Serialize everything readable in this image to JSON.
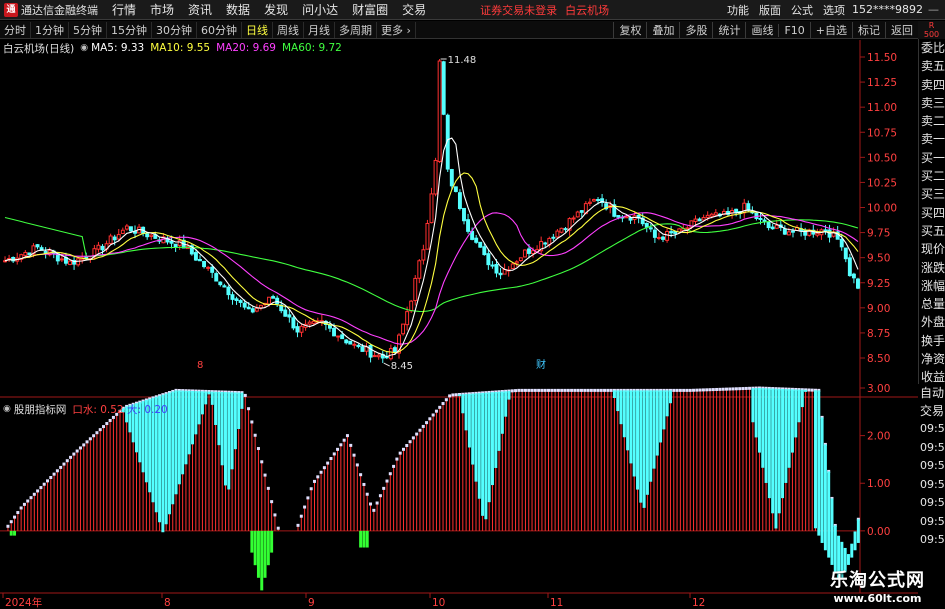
{
  "app": {
    "name": "通达信金融终端",
    "logo_text": "通"
  },
  "menu": [
    "行情",
    "市场",
    "资讯",
    "数据",
    "发现",
    "问小达",
    "财富圈",
    "交易"
  ],
  "warning": "证券交易未登录",
  "stock_name": "白云机场",
  "right_menu": [
    "功能",
    "版面",
    "公式",
    "选项"
  ],
  "user": "152****9892",
  "periods": [
    "分时",
    "1分钟",
    "5分钟",
    "15分钟",
    "30分钟",
    "60分钟",
    "日线",
    "周线",
    "月线",
    "多周期",
    "更多"
  ],
  "active_period": "日线",
  "right_tools": [
    "复权",
    "叠加",
    "多股",
    "统计",
    "画线",
    "F10",
    "+自选",
    "标记",
    "返回"
  ],
  "badge": {
    "line1": "R",
    "line2": "500"
  },
  "main_legend": {
    "title": "白云机场(日线)",
    "ma": [
      {
        "label": "MA5: 9.33",
        "color": "#ffffff"
      },
      {
        "label": "MA10: 9.55",
        "color": "#ffff40"
      },
      {
        "label": "MA20: 9.69",
        "color": "#ff40ff"
      },
      {
        "label": "MA60: 9.72",
        "color": "#40ff40"
      }
    ]
  },
  "sub_legend": {
    "title": "股朋指标网",
    "items": [
      {
        "label": "口水: 0.52",
        "color": "#ff4040"
      },
      {
        "label": "大: 0.20",
        "color": "#4040ff"
      }
    ]
  },
  "side_panel": [
    "委比",
    "卖五",
    "卖四",
    "卖三",
    "卖二",
    "卖一",
    "买一",
    "买二",
    "买三",
    "买四",
    "买五",
    "现价",
    "涨跌",
    "涨幅",
    "总量",
    "外盘",
    "换手",
    "净资",
    "收益"
  ],
  "side_panel2": {
    "auto": [
      "自动",
      "交易"
    ],
    "times": [
      "09:52",
      "09:52",
      "09:52",
      "09:52",
      "09:53",
      "09:53",
      "09:53"
    ]
  },
  "chart_data": [
    {
      "type": "candlestick",
      "price_axis": {
        "min": 8.5,
        "max": 11.5,
        "ticks": [
          11.5,
          11.25,
          11.0,
          10.75,
          10.5,
          10.25,
          10.0,
          9.75,
          9.5,
          9.25,
          9.0,
          8.75,
          8.5
        ]
      },
      "annotations": [
        {
          "label": "11.48",
          "value": 11.48
        },
        {
          "label": "8.45",
          "value": 8.45
        }
      ],
      "markers": [
        {
          "label": "8",
          "color": "#ff4040"
        },
        {
          "label": "财",
          "color": "#40c8ff"
        }
      ],
      "ma_colors": {
        "ma5": "#ffffff",
        "ma10": "#ffff40",
        "ma20": "#ff40ff",
        "ma60": "#40ff40"
      },
      "candle_colors": {
        "up": "#ff3030",
        "down": "#54ffff"
      }
    },
    {
      "type": "bar",
      "value_axis": {
        "min": -1.2,
        "max": 3.0,
        "ticks": [
          3.0,
          2.0,
          1.0,
          0.0
        ]
      },
      "colors": {
        "line": "#ff3030",
        "cyan": "#54ffff",
        "green": "#33ff33",
        "marker": "#e0e0ff"
      }
    }
  ],
  "date_axis": [
    "2024年",
    "8",
    "9",
    "10",
    "11",
    "12"
  ],
  "watermark": {
    "line1": "乐淘公式网",
    "line2": "www.60lt.com"
  }
}
